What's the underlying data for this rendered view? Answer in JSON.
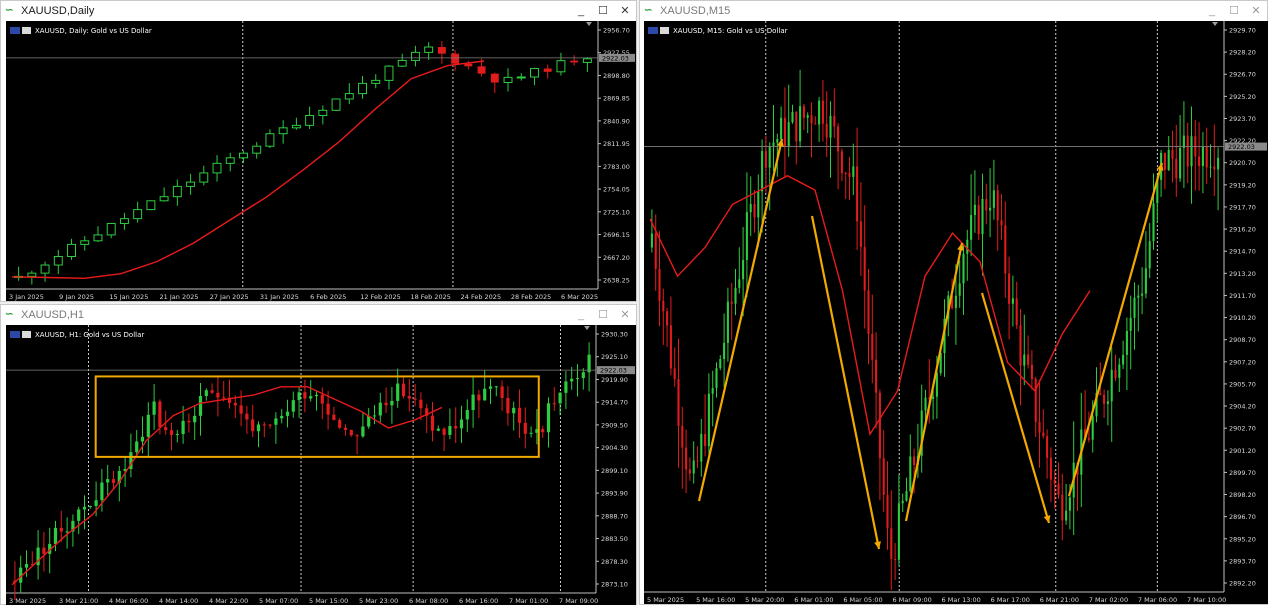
{
  "colors": {
    "bull": "#2ecc40",
    "bear": "#e11c1c",
    "ma": "#e81b1b",
    "grid": "#ffffff",
    "annot": "#f2a900",
    "box": "#f2a900",
    "bid": "#808080"
  },
  "windows": [
    {
      "key": "daily",
      "title": "XAUUSD,Daily",
      "header": "XAUUSD, Daily:  Gold vs US Dollar",
      "price_tag": "2922.03",
      "yticks": [
        "2956.70",
        "2927.55",
        "2898.80",
        "2869.85",
        "2840.90",
        "2811.95",
        "2783.00",
        "2754.05",
        "2725.10",
        "2696.15",
        "2667.20",
        "2638.25"
      ],
      "xticks": [
        "3 Jan 2025",
        "9 Jan 2025",
        "15 Jan 2025",
        "21 Jan 2025",
        "27 Jan 2025",
        "31 Jan 2025",
        "6 Feb 2025",
        "12 Feb 2025",
        "18 Feb 2025",
        "24 Feb 2025",
        "28 Feb 2025",
        "6 Mar 2025"
      ],
      "ylim": [
        2620,
        2965
      ],
      "ma_values": [
        2636,
        2635,
        2634,
        2640,
        2656,
        2680,
        2710,
        2740,
        2775,
        2812,
        2855,
        2895,
        2912,
        2918
      ]
    },
    {
      "key": "h1",
      "title": "XAUUSD,H1",
      "header": "XAUUSD, H1:  Gold vs US Dollar",
      "price_tag": "2922.03",
      "yticks": [
        "2930.30",
        "2925.10",
        "2919.90",
        "2914.70",
        "2909.50",
        "2904.30",
        "2899.10",
        "2893.90",
        "2888.70",
        "2883.50",
        "2878.30",
        "2873.10"
      ],
      "xticks": [
        "3 Mar 2025",
        "3 Mar 21:00",
        "4 Mar 06:00",
        "4 Mar 14:00",
        "4 Mar 22:00",
        "5 Mar 07:00",
        "5 Mar 15:00",
        "5 Mar 23:00",
        "6 Mar 08:00",
        "6 Mar 16:00",
        "7 Mar 01:00",
        "7 Mar 09:00"
      ],
      "ylim": [
        2868,
        2932
      ],
      "ma_values": [
        2870,
        2876,
        2882,
        2887,
        2895,
        2905,
        2911,
        2914,
        2915,
        2916,
        2918,
        2918,
        2915,
        2912,
        2908,
        2910,
        2913
      ]
    },
    {
      "key": "m15",
      "title": "XAUUSD,M15",
      "header": "XAUUSD, M15:  Gold vs US Dollar",
      "price_tag": "2922.03",
      "yticks": [
        "2929.70",
        "2928.20",
        "2926.70",
        "2925.20",
        "2923.70",
        "2922.20",
        "2920.70",
        "2919.20",
        "2917.70",
        "2916.20",
        "2914.70",
        "2913.20",
        "2911.70",
        "2910.20",
        "2908.70",
        "2907.20",
        "2905.70",
        "2904.20",
        "2902.70",
        "2901.20",
        "2899.70",
        "2898.20",
        "2896.70",
        "2895.20",
        "2893.70",
        "2892.20"
      ],
      "xticks": [
        "5 Mar 2025",
        "5 Mar 16:00",
        "5 Mar 20:00",
        "6 Mar 01:00",
        "6 Mar 05:00",
        "6 Mar 09:00",
        "6 Mar 13:00",
        "6 Mar 17:00",
        "6 Mar 21:00",
        "7 Mar 02:00",
        "7 Mar 06:00",
        "7 Mar 10:00"
      ],
      "ylim": [
        2891,
        2930.5
      ],
      "ma_values": [
        2917,
        2913,
        2915,
        2918,
        2919,
        2920,
        2919,
        2912,
        2902,
        2905,
        2913,
        2916,
        2914,
        2907,
        2905,
        2909,
        2912
      ]
    }
  ],
  "controls": {
    "minimize": "_",
    "maximize": "☐",
    "close": "✕"
  }
}
